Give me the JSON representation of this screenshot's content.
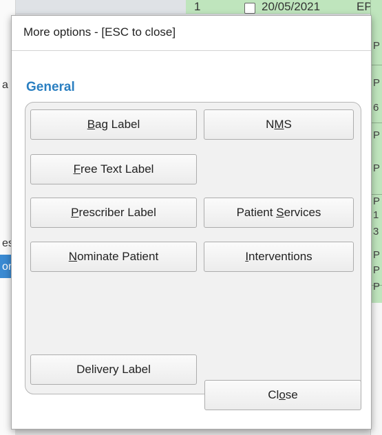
{
  "background": {
    "top_row": {
      "cell1": "1",
      "date": "20/05/2021",
      "tail": "EP"
    },
    "right_column_letters": [
      "P",
      "P",
      "6",
      "P",
      "P",
      "P",
      "1",
      "3",
      "P",
      "P",
      "P"
    ],
    "left_column_fragments": [
      "a",
      "es",
      "or"
    ]
  },
  "dialog": {
    "title": "More options - [ESC to close]",
    "section_title": "General",
    "buttons": {
      "bag_label": {
        "mnemonic": "B",
        "rest": "ag Label"
      },
      "nms": {
        "pre": "N",
        "mnemonic": "M",
        "rest": "S"
      },
      "free_text_label": {
        "mnemonic": "F",
        "rest": "ree Text Label"
      },
      "prescriber_label": {
        "mnemonic": "P",
        "rest": "rescriber Label"
      },
      "patient_services": {
        "pre": "Patient ",
        "mnemonic": "S",
        "rest": "ervices"
      },
      "nominate_patient": {
        "mnemonic": "N",
        "rest": "ominate Patient"
      },
      "interventions": {
        "mnemonic": "I",
        "rest": "nterventions"
      },
      "delivery_label": {
        "label": "Delivery Label"
      },
      "close": {
        "pre": "Cl",
        "mnemonic": "o",
        "rest": "se"
      }
    }
  }
}
